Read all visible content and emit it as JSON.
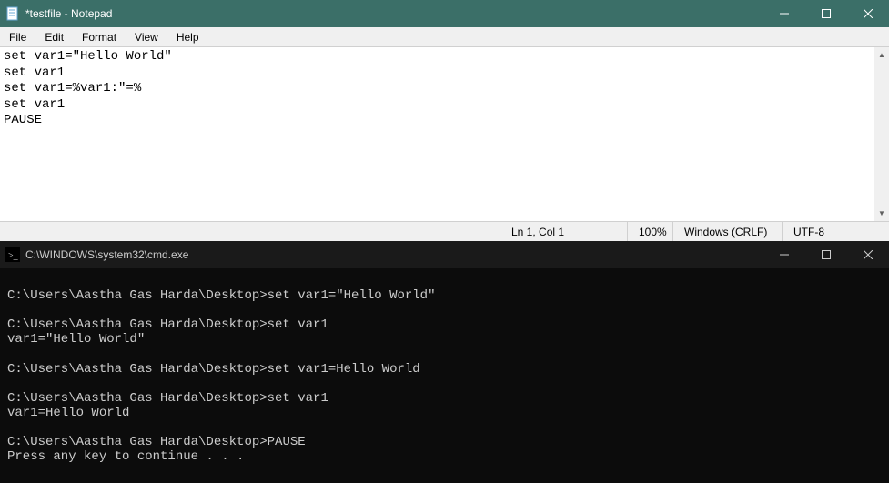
{
  "notepad": {
    "title": "*testfile - Notepad",
    "menu": {
      "file": "File",
      "edit": "Edit",
      "format": "Format",
      "view": "View",
      "help": "Help"
    },
    "content": "set var1=\"Hello World\"\nset var1\nset var1=%var1:\"=%\nset var1\nPAUSE",
    "statusbar": {
      "position": "Ln 1, Col 1",
      "zoom": "100%",
      "line_ending": "Windows (CRLF)",
      "encoding": "UTF-8"
    }
  },
  "cmd": {
    "title": "C:\\WINDOWS\\system32\\cmd.exe",
    "prompt": "C:\\Users\\Aastha Gas Harda\\Desktop>",
    "output": "\nC:\\Users\\Aastha Gas Harda\\Desktop>set var1=\"Hello World\"\n\nC:\\Users\\Aastha Gas Harda\\Desktop>set var1\nvar1=\"Hello World\"\n\nC:\\Users\\Aastha Gas Harda\\Desktop>set var1=Hello World\n\nC:\\Users\\Aastha Gas Harda\\Desktop>set var1\nvar1=Hello World\n\nC:\\Users\\Aastha Gas Harda\\Desktop>PAUSE\nPress any key to continue . . ."
  }
}
